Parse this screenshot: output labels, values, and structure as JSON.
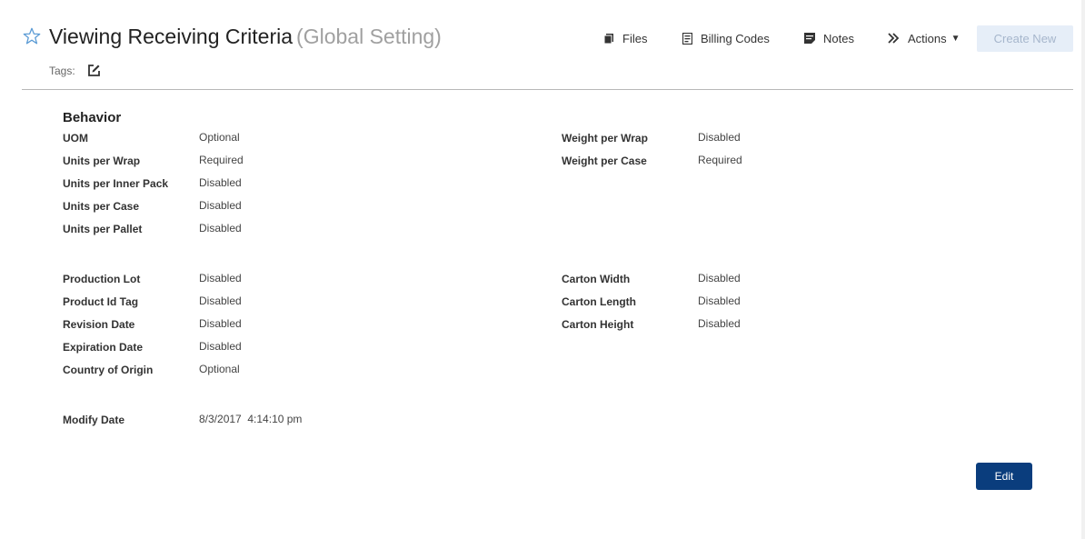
{
  "header": {
    "title": "Viewing Receiving Criteria",
    "subtitle": "(Global Setting)",
    "tags_label": "Tags:"
  },
  "toolbar": {
    "files_label": "Files",
    "billing_codes_label": "Billing Codes",
    "notes_label": "Notes",
    "actions_label": "Actions",
    "create_new_label": "Create New"
  },
  "section": {
    "title": "Behavior"
  },
  "fields": {
    "uom": {
      "label": "UOM",
      "value": "Optional"
    },
    "units_per_wrap": {
      "label": "Units per Wrap",
      "value": "Required"
    },
    "units_per_inner_pack": {
      "label": "Units per Inner Pack",
      "value": "Disabled"
    },
    "units_per_case": {
      "label": "Units per Case",
      "value": "Disabled"
    },
    "units_per_pallet": {
      "label": "Units per Pallet",
      "value": "Disabled"
    },
    "weight_per_wrap": {
      "label": "Weight per Wrap",
      "value": "Disabled"
    },
    "weight_per_case": {
      "label": "Weight per Case",
      "value": "Required"
    },
    "production_lot": {
      "label": "Production Lot",
      "value": "Disabled"
    },
    "product_id_tag": {
      "label": "Product Id Tag",
      "value": "Disabled"
    },
    "revision_date": {
      "label": "Revision Date",
      "value": "Disabled"
    },
    "expiration_date": {
      "label": "Expiration Date",
      "value": "Disabled"
    },
    "country_of_origin": {
      "label": "Country of Origin",
      "value": "Optional"
    },
    "carton_width": {
      "label": "Carton Width",
      "value": "Disabled"
    },
    "carton_length": {
      "label": "Carton Length",
      "value": "Disabled"
    },
    "carton_height": {
      "label": "Carton Height",
      "value": "Disabled"
    },
    "modify_date": {
      "label": "Modify Date",
      "value": "8/3/2017  4:14:10 pm"
    }
  },
  "footer": {
    "edit_label": "Edit"
  },
  "colors": {
    "star": "#5b9bd5",
    "primary_button": "#0a3d7d",
    "disabled_button_bg": "#e6eef8",
    "disabled_button_text": "#a6b6cc",
    "subtitle": "#a0a0a0"
  },
  "icons": {
    "favorite": "star-outline-icon",
    "files": "files-icon",
    "billing_codes": "document-icon",
    "notes": "notes-icon",
    "actions": "double-chevron-right-icon",
    "tags_edit": "edit-square-icon"
  }
}
